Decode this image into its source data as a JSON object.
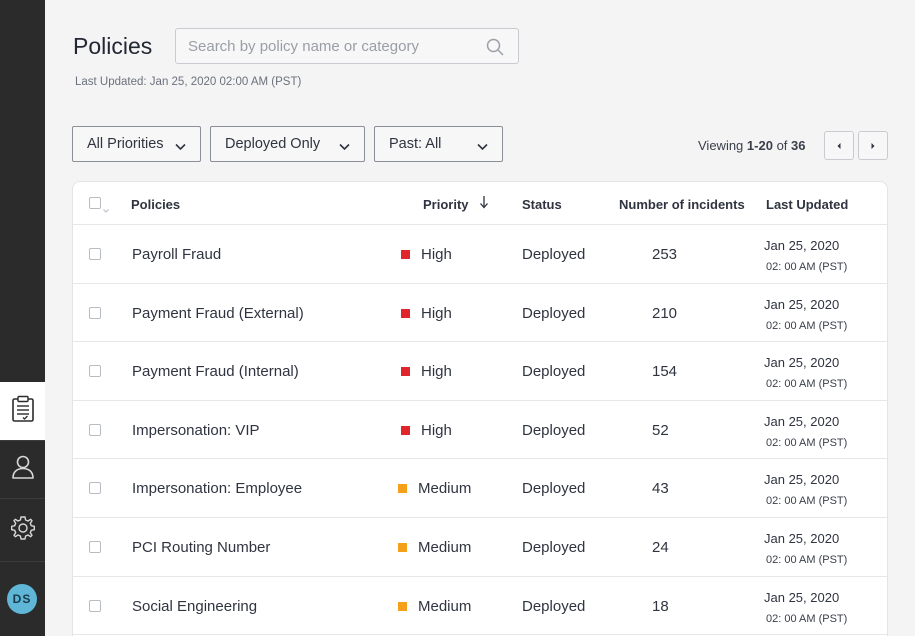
{
  "sidebar": {
    "items": [
      {
        "icon": "clipboard-icon",
        "active": true
      },
      {
        "icon": "user-icon",
        "active": false
      },
      {
        "icon": "gear-icon",
        "active": false
      }
    ],
    "avatar_initials": "DS"
  },
  "header": {
    "title": "Policies",
    "search_placeholder": "Search by policy name or category",
    "last_updated": "Last Updated: Jan 25, 2020 02:00 AM (PST)"
  },
  "filters": {
    "priority": "All Priorities",
    "deployment": "Deployed Only",
    "time": "Past: All"
  },
  "pagination": {
    "prefix": "Viewing",
    "range": "1-20",
    "of_label": "of",
    "total": "36"
  },
  "table": {
    "columns": [
      "Policies",
      "Priority",
      "Status",
      "Number of incidents",
      "Last Updated"
    ],
    "rows": [
      {
        "policy": "Payroll Fraud",
        "priority": "High",
        "status": "Deployed",
        "incidents": "253",
        "date": "Jan 25, 2020",
        "time": "02: 00 AM (PST)"
      },
      {
        "policy": "Payment Fraud (External)",
        "priority": "High",
        "status": "Deployed",
        "incidents": "210",
        "date": "Jan 25, 2020",
        "time": "02: 00 AM (PST)"
      },
      {
        "policy": "Payment Fraud (Internal)",
        "priority": "High",
        "status": "Deployed",
        "incidents": "154",
        "date": "Jan 25, 2020",
        "time": "02: 00 AM (PST)"
      },
      {
        "policy": "Impersonation: VIP",
        "priority": "High",
        "status": "Deployed",
        "incidents": "52",
        "date": "Jan 25, 2020",
        "time": "02: 00 AM (PST)"
      },
      {
        "policy": "Impersonation: Employee",
        "priority": "Medium",
        "status": "Deployed",
        "incidents": "43",
        "date": "Jan 25, 2020",
        "time": "02: 00 AM (PST)"
      },
      {
        "policy": "PCI Routing Number",
        "priority": "Medium",
        "status": "Deployed",
        "incidents": "24",
        "date": "Jan 25, 2020",
        "time": "02: 00 AM (PST)"
      },
      {
        "policy": "Social Engineering",
        "priority": "Medium",
        "status": "Deployed",
        "incidents": "18",
        "date": "Jan 25, 2020",
        "time": "02: 00 AM (PST)"
      }
    ]
  },
  "colors": {
    "priority_high": "#e0262b",
    "priority_medium": "#f5a01a",
    "sidebar_bg": "#2b2b2b",
    "avatar_bg": "#5fb6d6"
  }
}
